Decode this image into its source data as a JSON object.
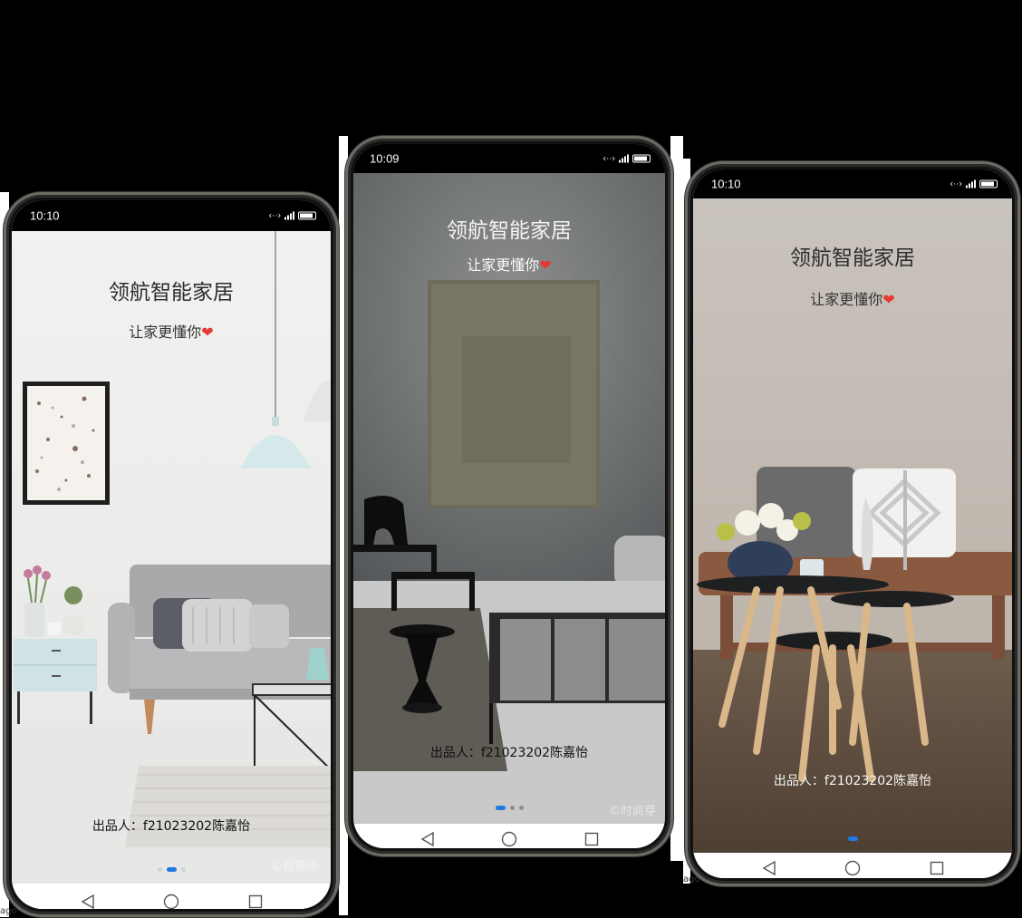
{
  "app": {
    "title": "领航智能家居",
    "tagline": "让家更懂你",
    "heart": "❤",
    "credit": "出品人：f21023202陈嘉怡"
  },
  "phones": [
    {
      "time": "10:10",
      "page_index": 2,
      "page_count": 3,
      "watermark": "©视觉中"
    },
    {
      "time": "10:09",
      "page_index": 1,
      "page_count": 3,
      "watermark": "©时尚芽"
    },
    {
      "time": "10:10",
      "page_index": 1,
      "page_count": 1,
      "watermark": ""
    }
  ],
  "status_icons": {
    "link": "‹··›",
    "data": "⁴ᴳ"
  },
  "navbar": {
    "icons": [
      "back-triangle-icon",
      "home-circle-icon",
      "recents-square-icon"
    ]
  },
  "colors": {
    "accent": "#1f7ae0",
    "heart": "#e53935",
    "status_bar": "#000000"
  },
  "edge_fragments": [
    "ago",
    "ago"
  ]
}
